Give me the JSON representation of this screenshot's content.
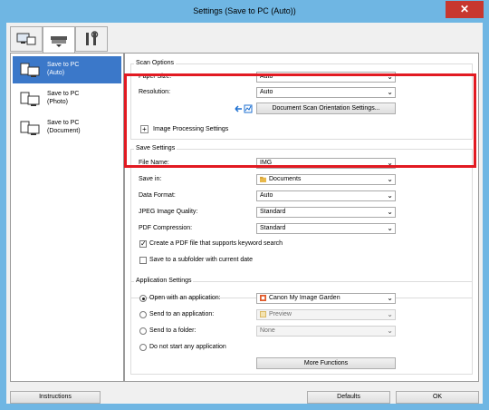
{
  "window": {
    "title": "Settings (Save to PC (Auto))",
    "close_glyph": "✕"
  },
  "tabs": [
    {
      "name": "scan-from-computer-tab-icon",
      "active": false
    },
    {
      "name": "scanner-button-tab-icon",
      "active": true
    },
    {
      "name": "general-settings-tab-icon",
      "active": false
    }
  ],
  "left_list": [
    {
      "line1": "Save to PC",
      "line2": "(Auto)",
      "selected": true
    },
    {
      "line1": "Save to PC",
      "line2": "(Photo)",
      "selected": false
    },
    {
      "line1": "Save to PC",
      "line2": "(Document)",
      "selected": false
    }
  ],
  "scan_options": {
    "title": "Scan Options",
    "paper_size_label": "Paper Size:",
    "paper_size_value": "Auto",
    "resolution_label": "Resolution:",
    "resolution_value": "Auto",
    "orientation_button": "Document Scan Orientation Settings...",
    "image_processing_label": "Image Processing Settings",
    "expand_glyph": "+"
  },
  "save_settings": {
    "title": "Save Settings",
    "file_name_label": "File Name:",
    "file_name_value": "IMG",
    "save_in_label": "Save in:",
    "save_in_value": "Documents",
    "data_format_label": "Data Format:",
    "data_format_value": "Auto",
    "jpeg_quality_label": "JPEG Image Quality:",
    "jpeg_quality_value": "Standard",
    "pdf_compression_label": "PDF Compression:",
    "pdf_compression_value": "Standard",
    "keyword_pdf_label": "Create a PDF file that supports keyword search",
    "keyword_pdf_checked": true,
    "subfolder_label": "Save to a subfolder with current date",
    "subfolder_checked": false
  },
  "app_settings": {
    "title": "Application Settings",
    "open_app_label": "Open with an application:",
    "open_app_value": "Canon My Image Garden",
    "send_app_label": "Send to an application:",
    "send_app_value": "Preview",
    "send_folder_label": "Send to a folder:",
    "send_folder_value": "None",
    "no_app_label": "Do not start any application",
    "more_functions": "More Functions",
    "selected_option": "open_app"
  },
  "footer": {
    "instructions": "Instructions",
    "defaults": "Defaults",
    "ok": "OK"
  },
  "dropdown_glyph": "⌄",
  "colors": {
    "selection": "#3b78c9",
    "highlight": "#e21a22",
    "titlebar": "#6fb6e3",
    "close": "#c7372f"
  }
}
